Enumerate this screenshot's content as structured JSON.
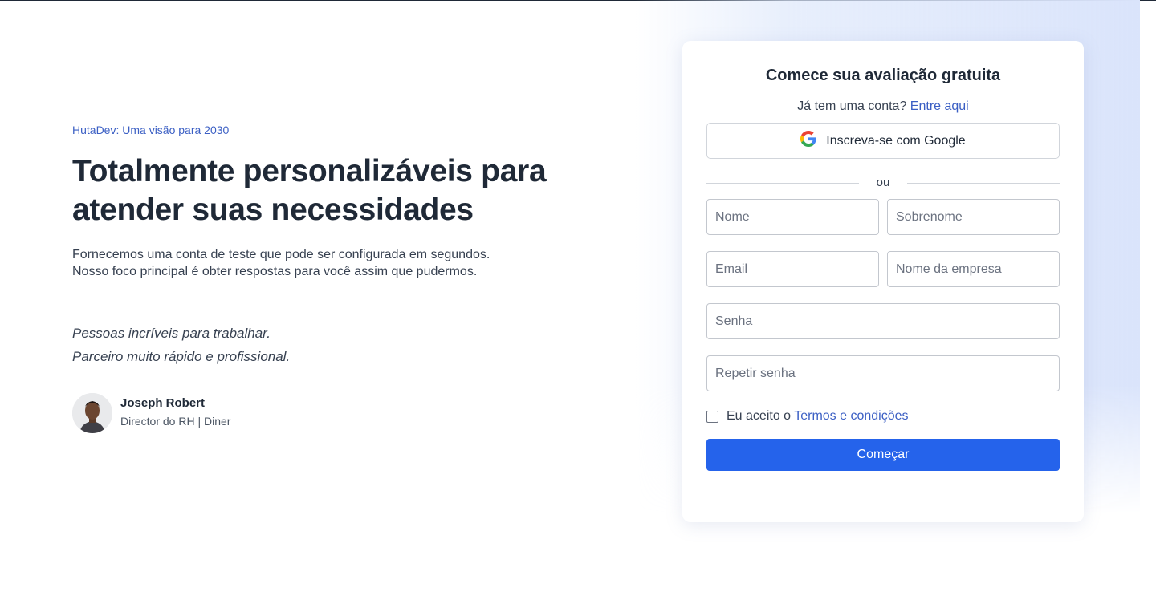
{
  "hero": {
    "eyebrow": "HutaDev: Uma visão para 2030",
    "headline_line1": "Totalmente personalizáveis para",
    "headline_line2": "atender suas necessidades",
    "description_line1": "Fornecemos uma conta de teste que pode ser configurada em segundos.",
    "description_line2": "Nosso foco principal é obter respostas para você assim que pudermos.",
    "quote_line1": "Pessoas incríveis para trabalhar.",
    "quote_line2": "Parceiro muito rápido e profissional.",
    "author_name": "Joseph Robert",
    "author_role": "Director do RH | Diner"
  },
  "signup": {
    "title": "Comece sua avaliação gratuita",
    "have_account": "Já tem uma conta?",
    "login_link": "Entre aqui",
    "google_button": "Inscreva-se com Google",
    "divider": "ou",
    "first_name_placeholder": "Nome",
    "last_name_placeholder": "Sobrenome",
    "email_placeholder": "Email",
    "company_placeholder": "Nome da empresa",
    "password_placeholder": "Senha",
    "repeat_password_placeholder": "Repetir senha",
    "terms_prefix": "Eu aceito o",
    "terms_link": "Termos e condições",
    "submit": "Começar"
  },
  "colors": {
    "accent": "#2563eb",
    "link": "#3b5fc4",
    "text": "#1f2937"
  }
}
